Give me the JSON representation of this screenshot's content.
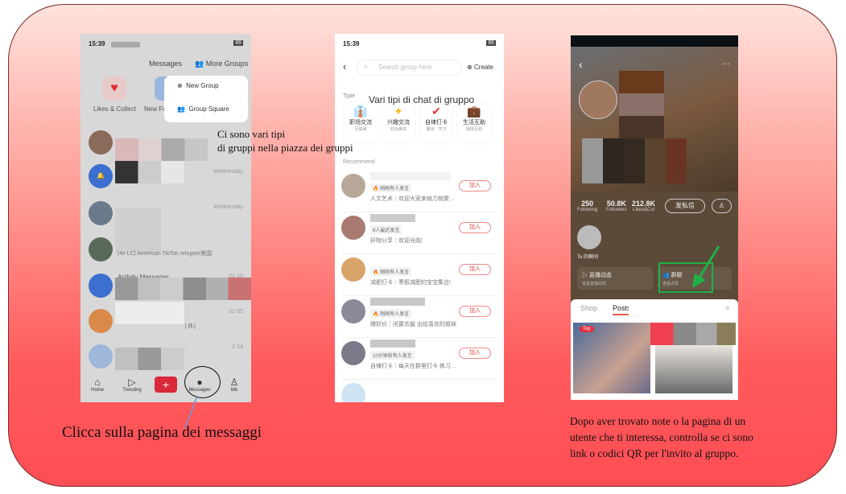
{
  "captions": {
    "groups_square": "Ci sono vari tipi\ndi gruppi nella piazza dei gruppi",
    "click_messages": "Clicca sulla pagina dei messaggi",
    "group_types": "Vari tipi di chat di gruppo",
    "profile_tip": "Dopo aver trovato note o la pagina di un utente che ti interessa, controlla se ci sono link o codici QR per l'invito al gruppo."
  },
  "colors": {
    "accent": "#e0303c",
    "highlight_box": "#1fb14a",
    "arrow": "#1fb14a",
    "circle": "#111111"
  },
  "phone1": {
    "status_time": "15:39",
    "status_battery": "86",
    "header": {
      "messages": "Messages",
      "more_groups": "More Groups"
    },
    "shortcuts": [
      {
        "label": "Likes & Collect",
        "icon": "heart-icon"
      },
      {
        "label": "New Fo",
        "icon": "user-icon"
      }
    ],
    "menu": [
      {
        "label": "New Group",
        "icon": "plus-chat-icon"
      },
      {
        "label": "Group Square",
        "icon": "users-icon"
      }
    ],
    "conversations": [
      {
        "time": ""
      },
      {
        "time": "Wednesday"
      },
      {
        "time": "Wednesday"
      },
      {
        "time": "",
        "preview": "[4e LC] American TikTok refugee/美国"
      },
      {
        "time": "01-10",
        "title": "Activity Messages"
      },
      {
        "time": "01-05",
        "preview": "[.动.]"
      },
      {
        "time": "2-14"
      }
    ],
    "nav": [
      {
        "label": "Home",
        "icon": "home-icon"
      },
      {
        "label": "Trending",
        "icon": "play-icon"
      },
      {
        "label": "",
        "icon": "plus-icon"
      },
      {
        "label": "Messages",
        "icon": "chat-icon"
      },
      {
        "label": "Me",
        "icon": "user-icon"
      }
    ]
  },
  "phone2": {
    "status_time": "15:39",
    "status_battery": "86",
    "search_placeholder": "Search group here",
    "create": "Create",
    "type_label": "Type",
    "types": [
      {
        "name": "职场交流",
        "sub": "互联网"
      },
      {
        "name": "兴趣交流",
        "sub": "时尚美妆"
      },
      {
        "name": "自律打卡",
        "sub": "健身、学习"
      },
      {
        "name": "生活互助",
        "sub": "姐妹互助"
      }
    ],
    "recommend_label": "Recommend",
    "groups": [
      {
        "tag": "🔥 刚刚有人发言",
        "desc": "人文艺术｜欢迎大家来格力桃聚…",
        "join": "加入"
      },
      {
        "tag": "6人最近发言",
        "desc": "好物分享｜欢迎光临!",
        "join": "加入"
      },
      {
        "tag": "🔥 刚刚有人发言",
        "desc": "减肥打卡｜寒假减肥的宝宝集合!",
        "join": "加入"
      },
      {
        "tag": "🔥 刚刚有人发言",
        "desc": "蹲好价｜闲置衣服 出给喜欢的姐妹",
        "join": "加入"
      },
      {
        "tag": "10分钟前有人发言",
        "desc": "自律打卡｜每天在群里打卡 练习…",
        "join": "加入"
      }
    ]
  },
  "phone3": {
    "stats": [
      {
        "value": "250",
        "label": "Following"
      },
      {
        "value": "50.8K",
        "label": "Followers"
      },
      {
        "value": "212.8K",
        "label": "Likes&Col"
      }
    ],
    "message_button": "发私信",
    "moments_label": "Ta 的瞬间",
    "cards": [
      {
        "title": "直播动态",
        "sub": "查看直播动态"
      },
      {
        "title": "群聊",
        "sub": "查看详情"
      }
    ],
    "tabs": [
      {
        "label": "Shop",
        "active": false
      },
      {
        "label": "Posts",
        "active": true
      }
    ],
    "top_badge": "Top"
  }
}
